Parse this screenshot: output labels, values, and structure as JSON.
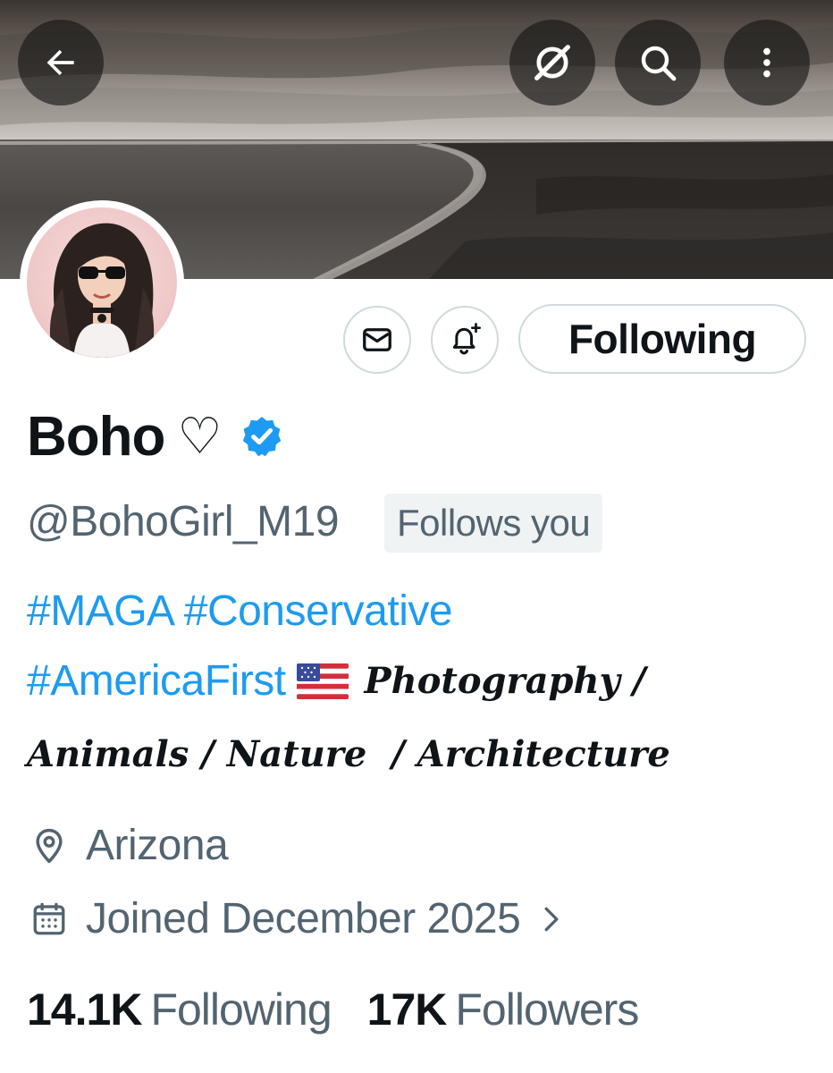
{
  "header": {
    "back_icon": "arrow-left-icon",
    "grok_icon": "grok-icon",
    "search_icon": "search-icon",
    "more_icon": "more-vertical-icon"
  },
  "actions": {
    "message_icon": "envelope-icon",
    "notify_icon": "bell-plus-icon",
    "follow_label": "Following"
  },
  "profile": {
    "display_name": "Boho",
    "heart": "♡",
    "verified_icon": "verified-badge-icon",
    "handle": "@BohoGirl_M19",
    "follows_you": "Follows you"
  },
  "bio": {
    "tag1": "#MAGA",
    "tag2": "#Conservative",
    "tag3": "#AmericaFirst",
    "flag_icon": "us-flag-icon",
    "line2_text": "Photography /",
    "line3_text": "Animals / Nature  / Architecture"
  },
  "meta": {
    "location_icon": "location-pin-icon",
    "location": "Arizona",
    "joined_icon": "calendar-icon",
    "joined": "Joined December 2025"
  },
  "stats": {
    "following_count": "14.1K",
    "following_label": "Following",
    "followers_count": "17K",
    "followers_label": "Followers"
  },
  "colors": {
    "link": "#1d9bf0",
    "secondary_text": "#536471",
    "primary_text": "#0f1419",
    "border": "#cfd9de"
  }
}
